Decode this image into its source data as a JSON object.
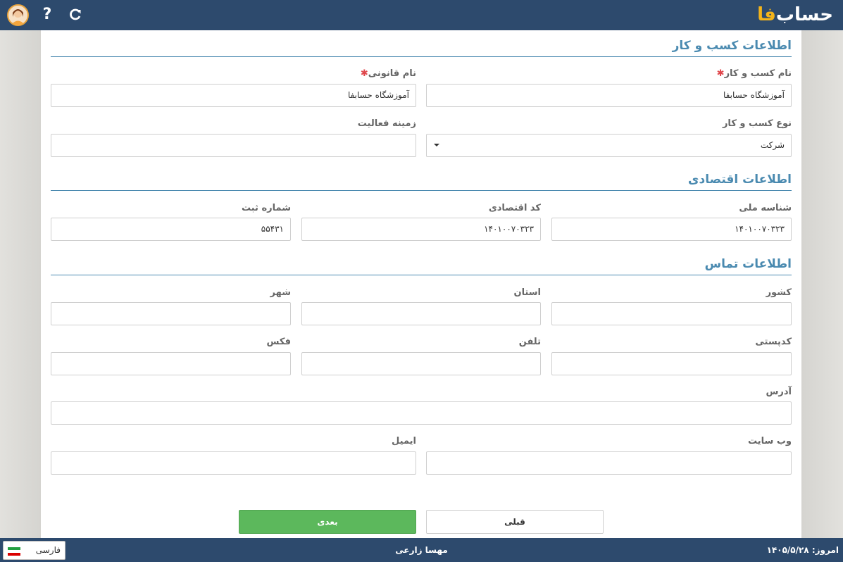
{
  "header": {
    "logo_main": "حساب",
    "logo_accent": "فا",
    "help_icon": "question-icon",
    "refresh_icon": "refresh-icon",
    "avatar_icon": "user-avatar-icon"
  },
  "business": {
    "title": "اطلاعات کسب و کار",
    "name_label": "نام کسب و کار",
    "name_value": "آموزشگاه حسابفا",
    "legal_label": "نام قانونی",
    "legal_value": "آموزشگاه حسابفا",
    "type_label": "نوع کسب و کار",
    "type_value": "شرکت",
    "field_label": "زمینه فعالیت",
    "field_value": ""
  },
  "economic": {
    "title": "اطلاعات اقتصادی",
    "national_id_label": "شناسه ملی",
    "national_id_value": "۱۴۰۱۰۰۷۰۳۲۳",
    "economic_code_label": "کد اقتصادی",
    "economic_code_value": "۱۴۰۱۰۰۷۰۳۲۳",
    "reg_number_label": "شماره ثبت",
    "reg_number_value": "۵۵۴۳۱"
  },
  "contact": {
    "title": "اطلاعات تماس",
    "country_label": "کشور",
    "province_label": "استان",
    "city_label": "شهر",
    "postal_label": "کدپستی",
    "phone_label": "تلفن",
    "fax_label": "فکس",
    "address_label": "آدرس",
    "website_label": "وب سایت",
    "email_label": "ایمیل"
  },
  "actions": {
    "prev_label": "قبلی",
    "next_label": "بعدی"
  },
  "status": {
    "today": "امروز: ۱۴۰۵/۵/۲۸",
    "user": "مهسا زارعی",
    "language": "فارسی"
  },
  "colors": {
    "header_bg": "#2d4a6d",
    "accent": "#4a8ab0",
    "next_button": "#5cb85c",
    "required": "#e0474c"
  }
}
